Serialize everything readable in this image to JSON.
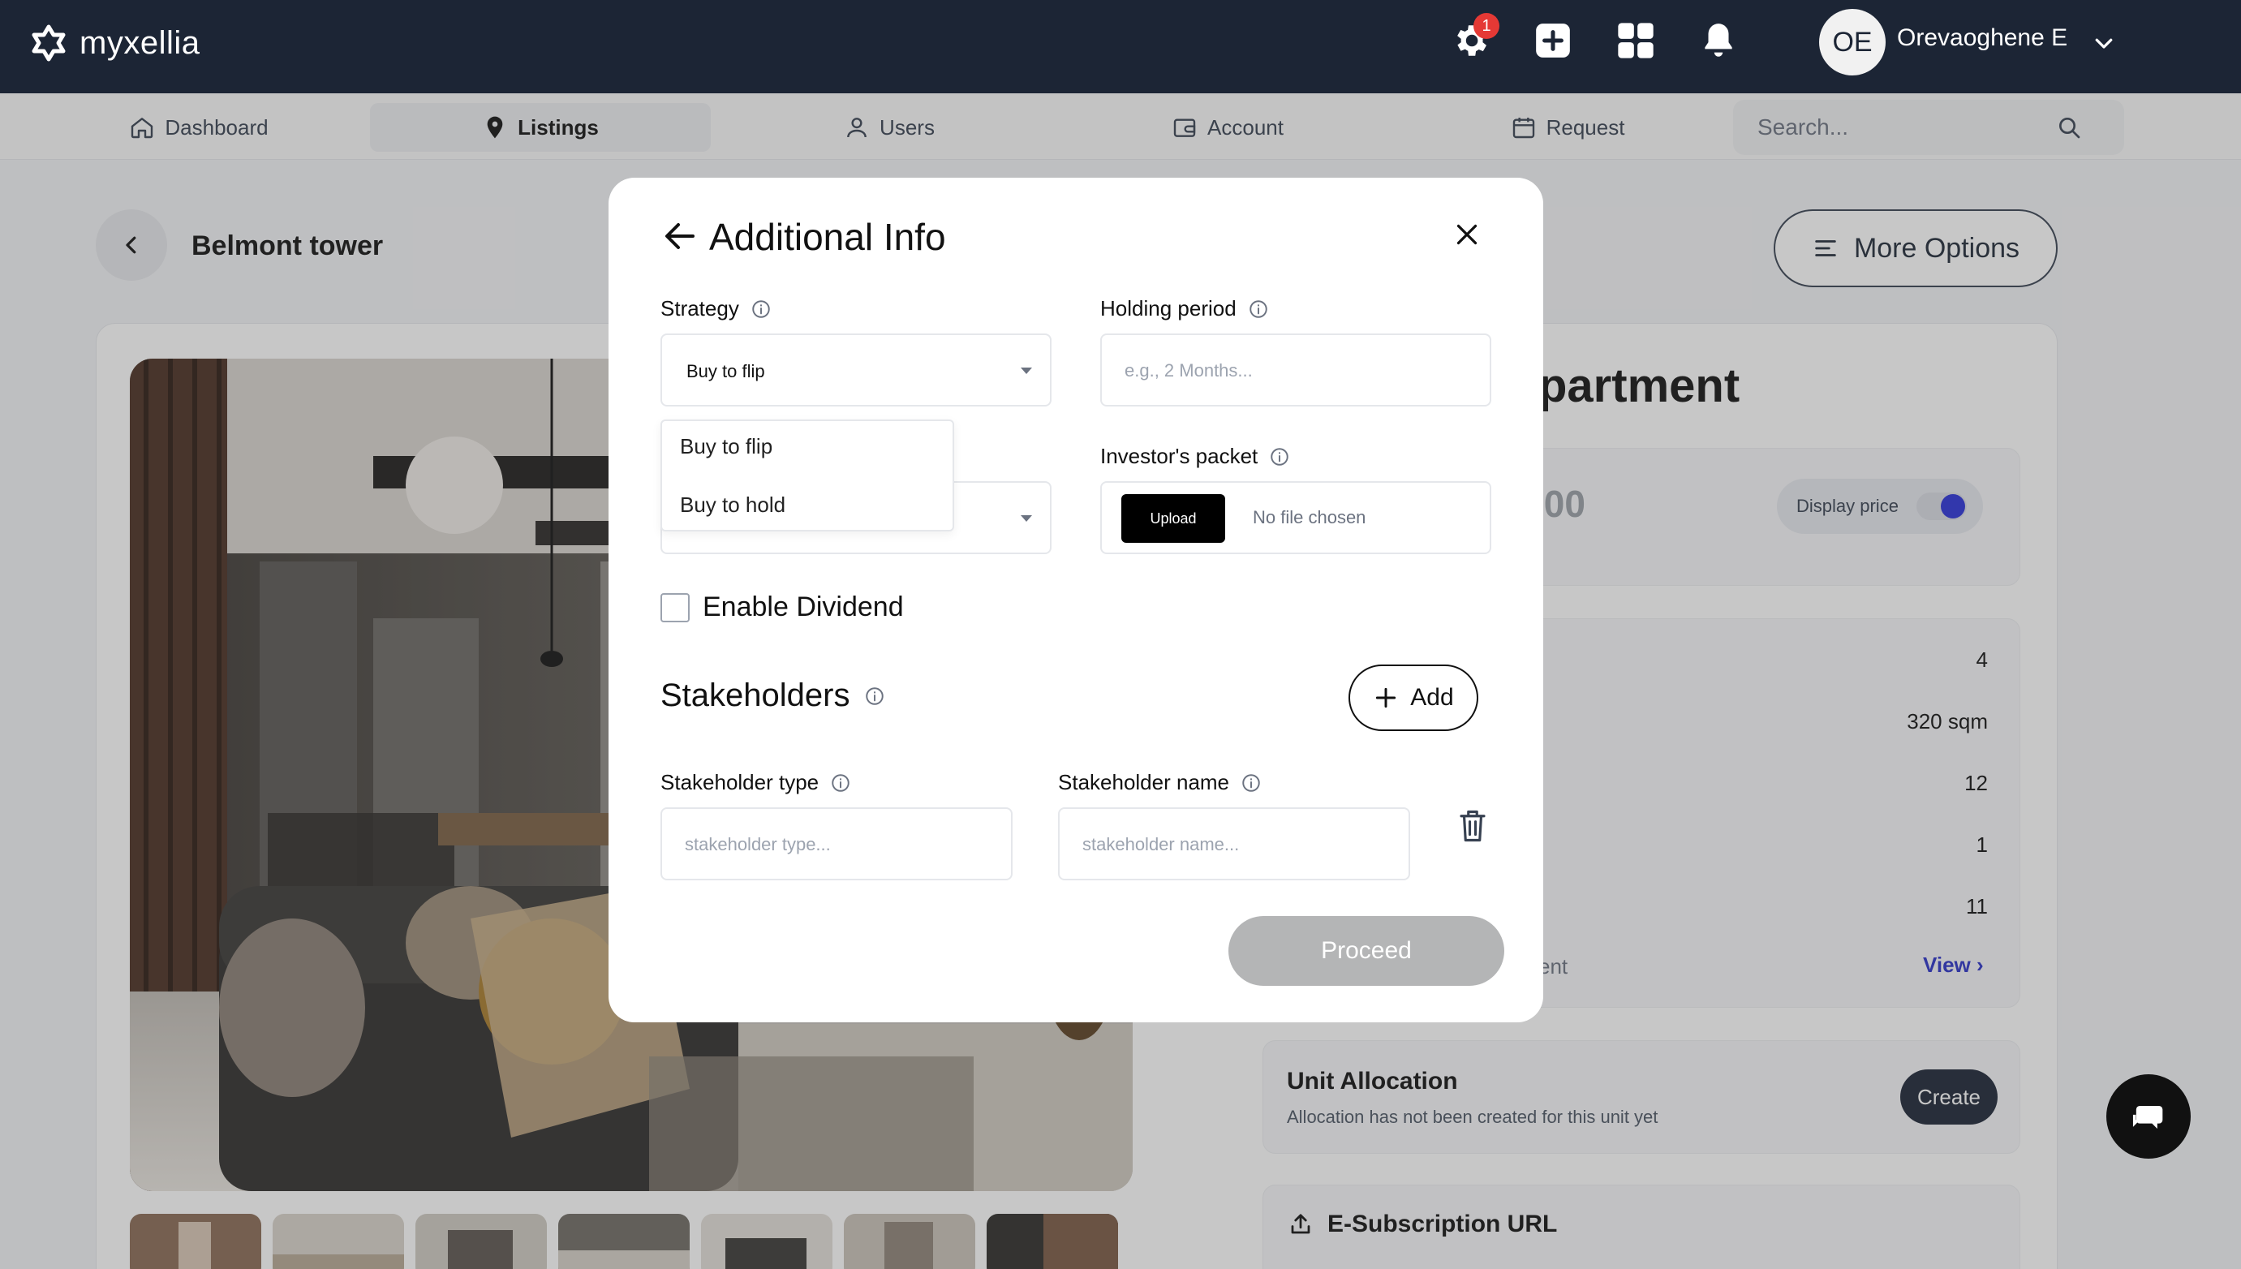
{
  "brand": {
    "name": "myxellia"
  },
  "topbar": {
    "settings_badge": "1",
    "user_initials": "OE",
    "user_name": "Orevaoghene E"
  },
  "nav": {
    "items": [
      {
        "label": "Dashboard",
        "icon": "home-icon"
      },
      {
        "label": "Listings",
        "icon": "location-pin-icon",
        "active": true
      },
      {
        "label": "Users",
        "icon": "user-icon"
      },
      {
        "label": "Account",
        "icon": "wallet-icon"
      },
      {
        "label": "Request",
        "icon": "calendar-icon"
      }
    ],
    "search_placeholder": "Search..."
  },
  "page": {
    "title": "Belmont tower",
    "more_options": "More Options",
    "listing_heading_fragment": "partment",
    "price_fragment": ".00",
    "display_price_label": "Display price",
    "display_price_on": true,
    "detail_values": [
      "4",
      "320 sqm",
      "12",
      "1",
      "11"
    ],
    "detail_label_fragment": "ent",
    "view_link": "View ›",
    "unit_allocation": {
      "title": "Unit Allocation",
      "subtitle": "Allocation has not been created for this unit yet",
      "button": "Create"
    },
    "e_subscription": {
      "title": "E-Subscription URL"
    }
  },
  "modal": {
    "title": "Additional Info",
    "strategy": {
      "label": "Strategy",
      "value": "Buy to flip",
      "options": [
        "Buy to flip",
        "Buy to hold"
      ]
    },
    "holding_period": {
      "label": "Holding period",
      "placeholder": "e.g., 2 Months..."
    },
    "investors_packet": {
      "label": "Investor's packet",
      "upload_label": "Upload",
      "file_status": "No file chosen"
    },
    "enable_dividend": {
      "label": "Enable Dividend",
      "checked": false
    },
    "stakeholders": {
      "heading": "Stakeholders",
      "add_label": "Add",
      "type_label": "Stakeholder type",
      "type_placeholder": "stakeholder type...",
      "name_label": "Stakeholder name",
      "name_placeholder": "stakeholder name..."
    },
    "proceed_label": "Proceed"
  },
  "colors": {
    "topbar": "#1c2535",
    "accent_blue": "#2a31d8",
    "proceed_disabled": "#b4b5b6",
    "badge_red": "#e53935"
  }
}
